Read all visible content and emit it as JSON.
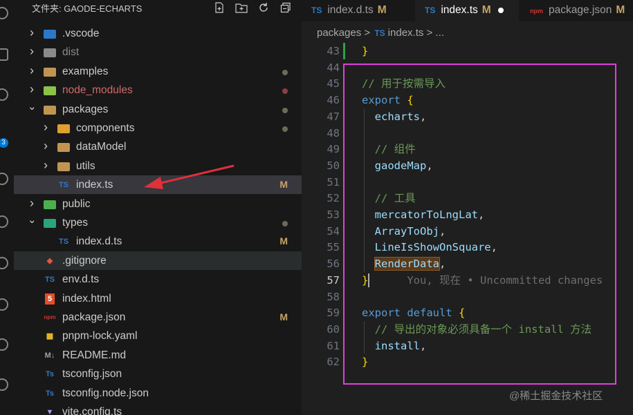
{
  "explorer": {
    "title": "文件夹: GAODE-ECHARTS",
    "actions": [
      "new-file",
      "new-folder",
      "refresh",
      "collapse-all"
    ],
    "items": [
      {
        "label": ".vscode",
        "type": "folder",
        "expanded": false,
        "depth": 0,
        "status": ""
      },
      {
        "label": "dist",
        "type": "folder",
        "expanded": false,
        "depth": 0,
        "status": ""
      },
      {
        "label": "examples",
        "type": "folder",
        "expanded": false,
        "depth": 0,
        "status": "dot"
      },
      {
        "label": "node_modules",
        "type": "folder",
        "expanded": false,
        "depth": 0,
        "status": "dot"
      },
      {
        "label": "packages",
        "type": "folder",
        "expanded": true,
        "depth": 0,
        "status": "dot"
      },
      {
        "label": "components",
        "type": "folder",
        "expanded": false,
        "depth": 1,
        "status": "dot"
      },
      {
        "label": "dataModel",
        "type": "folder",
        "expanded": false,
        "depth": 1,
        "status": ""
      },
      {
        "label": "utils",
        "type": "folder",
        "expanded": false,
        "depth": 1,
        "status": ""
      },
      {
        "label": "index.ts",
        "type": "ts",
        "depth": 1,
        "status": "M"
      },
      {
        "label": "public",
        "type": "folder",
        "expanded": false,
        "depth": 0,
        "status": ""
      },
      {
        "label": "types",
        "type": "folder",
        "expanded": true,
        "depth": 0,
        "status": "dot"
      },
      {
        "label": "index.d.ts",
        "type": "ts",
        "depth": 1,
        "status": "M"
      },
      {
        "label": ".gitignore",
        "type": "git",
        "depth": 0,
        "status": ""
      },
      {
        "label": "env.d.ts",
        "type": "ts",
        "depth": 0,
        "status": ""
      },
      {
        "label": "index.html",
        "type": "html",
        "depth": 0,
        "status": ""
      },
      {
        "label": "package.json",
        "type": "npm",
        "depth": 0,
        "status": "M"
      },
      {
        "label": "pnpm-lock.yaml",
        "type": "yaml",
        "depth": 0,
        "status": ""
      },
      {
        "label": "README.md",
        "type": "md",
        "depth": 0,
        "status": ""
      },
      {
        "label": "tsconfig.json",
        "type": "tsconfig",
        "depth": 0,
        "status": ""
      },
      {
        "label": "tsconfig.node.json",
        "type": "tsconfig",
        "depth": 0,
        "status": ""
      },
      {
        "label": "vite.config.ts",
        "type": "vite",
        "depth": 0,
        "status": ""
      }
    ],
    "selected_index": 8,
    "hover_index": 12
  },
  "activity_bar": {
    "badge": "3"
  },
  "tabs": [
    {
      "label": "index.d.ts",
      "icon": "TS",
      "modified": "M",
      "active": false
    },
    {
      "label": "index.ts",
      "icon": "TS",
      "modified": "M",
      "active": true,
      "dirty": true
    },
    {
      "label": "package.json",
      "icon": "npm",
      "modified": "M",
      "active": false
    }
  ],
  "breadcrumb": {
    "folder": "packages",
    "sep": ">",
    "file_icon": "TS",
    "file": "index.ts",
    "more": "..."
  },
  "code": {
    "current_line": 57,
    "lines": [
      {
        "n": 43,
        "text": "}"
      },
      {
        "n": 44,
        "text": ""
      },
      {
        "n": 45,
        "text": "// 用于按需导入"
      },
      {
        "n": 46,
        "text": "export {"
      },
      {
        "n": 47,
        "text": "  echarts,"
      },
      {
        "n": 48,
        "text": ""
      },
      {
        "n": 49,
        "text": "  // 组件"
      },
      {
        "n": 50,
        "text": "  gaodeMap,"
      },
      {
        "n": 51,
        "text": ""
      },
      {
        "n": 52,
        "text": "  // 工具"
      },
      {
        "n": 53,
        "text": "  mercatorToLngLat,"
      },
      {
        "n": 54,
        "text": "  ArrayToObj,"
      },
      {
        "n": 55,
        "text": "  LineIsShowOnSquare,"
      },
      {
        "n": 56,
        "text": "  RenderData,"
      },
      {
        "n": 57,
        "text": "}"
      },
      {
        "n": 58,
        "text": ""
      },
      {
        "n": 59,
        "text": "export default {"
      },
      {
        "n": 60,
        "text": "  // 导出的对象必须具备一个 install 方法"
      },
      {
        "n": 61,
        "text": "  install,"
      },
      {
        "n": 62,
        "text": "}"
      }
    ],
    "blame": "You, 现在 • Uncommitted changes"
  },
  "watermark": "@稀土掘金技术社区",
  "colors": {
    "annotation_box": "#e040e0",
    "arrow": "#e0303a",
    "git_added": "#2ea043"
  }
}
